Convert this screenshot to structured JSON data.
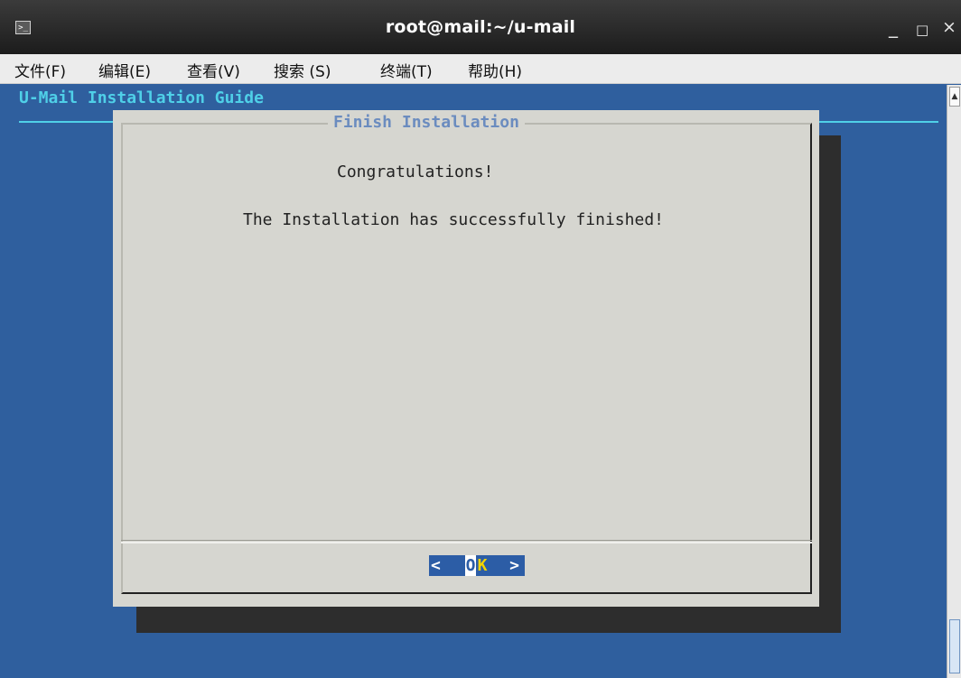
{
  "window": {
    "title": "root@mail:~/u-mail",
    "icon": "terminal-icon",
    "controls": {
      "minimize": "_",
      "maximize": "□",
      "close": "×"
    }
  },
  "menu": [
    {
      "label": "文件(F)"
    },
    {
      "label": "编辑(E)"
    },
    {
      "label": "查看(V)"
    },
    {
      "label": "搜索 (S)"
    },
    {
      "label": "终端(T)"
    },
    {
      "label": "帮助(H)"
    }
  ],
  "terminal": {
    "guide_title": "U-Mail Installation Guide",
    "dialog": {
      "title": "Finish Installation",
      "line1": "Congratulations!",
      "line2": "The Installation has successfully finished!",
      "ok_button": {
        "left": "<",
        "o": "O",
        "k": "K",
        "right": ">"
      }
    }
  },
  "colors": {
    "background": "#2f5f9e",
    "dialog": "#d6d6d0",
    "accent": "#4fd0e8",
    "button": "#2c5da6"
  }
}
